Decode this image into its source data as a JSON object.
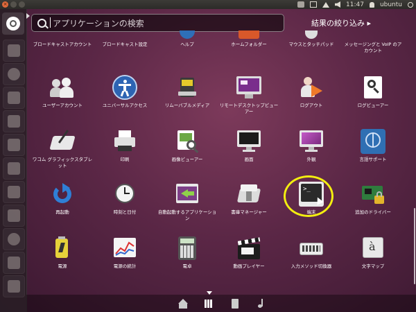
{
  "top_panel": {
    "time": "11:47",
    "user": "ubuntu"
  },
  "search": {
    "placeholder": "アプリケーションの検索"
  },
  "filter": {
    "label": "結果の絞り込み ▸"
  },
  "apps": [
    {
      "label": "ブロードキャストアカウント",
      "icon": "broadcast-accounts-icon"
    },
    {
      "label": "ブロードキャスト設定",
      "icon": "broadcast-settings-icon"
    },
    {
      "label": "ヘルプ",
      "icon": "help-icon"
    },
    {
      "label": "ホームフォルダー",
      "icon": "home-folder-icon"
    },
    {
      "label": "マウスとタッチパッド",
      "icon": "mouse-icon"
    },
    {
      "label": "メッセージングと VoIP のアカウント",
      "icon": "messaging-icon"
    },
    {
      "label": "ユーザーアカウント",
      "icon": "users-icon"
    },
    {
      "label": "ユニバーサルアクセス",
      "icon": "accessibility-icon"
    },
    {
      "label": "リムーバブルメディア",
      "icon": "removable-media-icon"
    },
    {
      "label": "リモートデスクトップビューアー",
      "icon": "remote-desktop-icon"
    },
    {
      "label": "ログアウト",
      "icon": "logout-icon"
    },
    {
      "label": "ログビューアー",
      "icon": "log-viewer-icon"
    },
    {
      "label": "ワコム グラフィックスタブレット",
      "icon": "wacom-tablet-icon"
    },
    {
      "label": "印刷",
      "icon": "printer-icon"
    },
    {
      "label": "画像ビューアー",
      "icon": "image-viewer-icon"
    },
    {
      "label": "画面",
      "icon": "display-icon"
    },
    {
      "label": "外観",
      "icon": "appearance-icon"
    },
    {
      "label": "言語サポート",
      "icon": "language-support-icon"
    },
    {
      "label": "再起動",
      "icon": "restart-icon"
    },
    {
      "label": "時刻と日付",
      "icon": "clock-icon"
    },
    {
      "label": "自動起動するアプリケーション",
      "icon": "startup-apps-icon"
    },
    {
      "label": "書庫マネージャー",
      "icon": "archive-manager-icon"
    },
    {
      "label": "端末",
      "icon": "terminal-icon"
    },
    {
      "label": "追加のドライバー",
      "icon": "additional-drivers-icon"
    },
    {
      "label": "電源",
      "icon": "power-icon"
    },
    {
      "label": "電源の統計",
      "icon": "power-statistics-icon"
    },
    {
      "label": "電卓",
      "icon": "calculator-icon"
    },
    {
      "label": "動画プレイヤー",
      "icon": "video-player-icon"
    },
    {
      "label": "入力メソッド切換器",
      "icon": "keyboard-icon"
    },
    {
      "label": "文字マップ",
      "icon": "character-map-icon"
    }
  ],
  "lenses": [
    "home-lens-icon",
    "applications-lens-icon",
    "files-lens-icon",
    "music-lens-icon"
  ],
  "colors": {
    "highlight_ring": "#f3ee10",
    "panel": "#3c3b37",
    "close_button": "#e06a3c"
  }
}
